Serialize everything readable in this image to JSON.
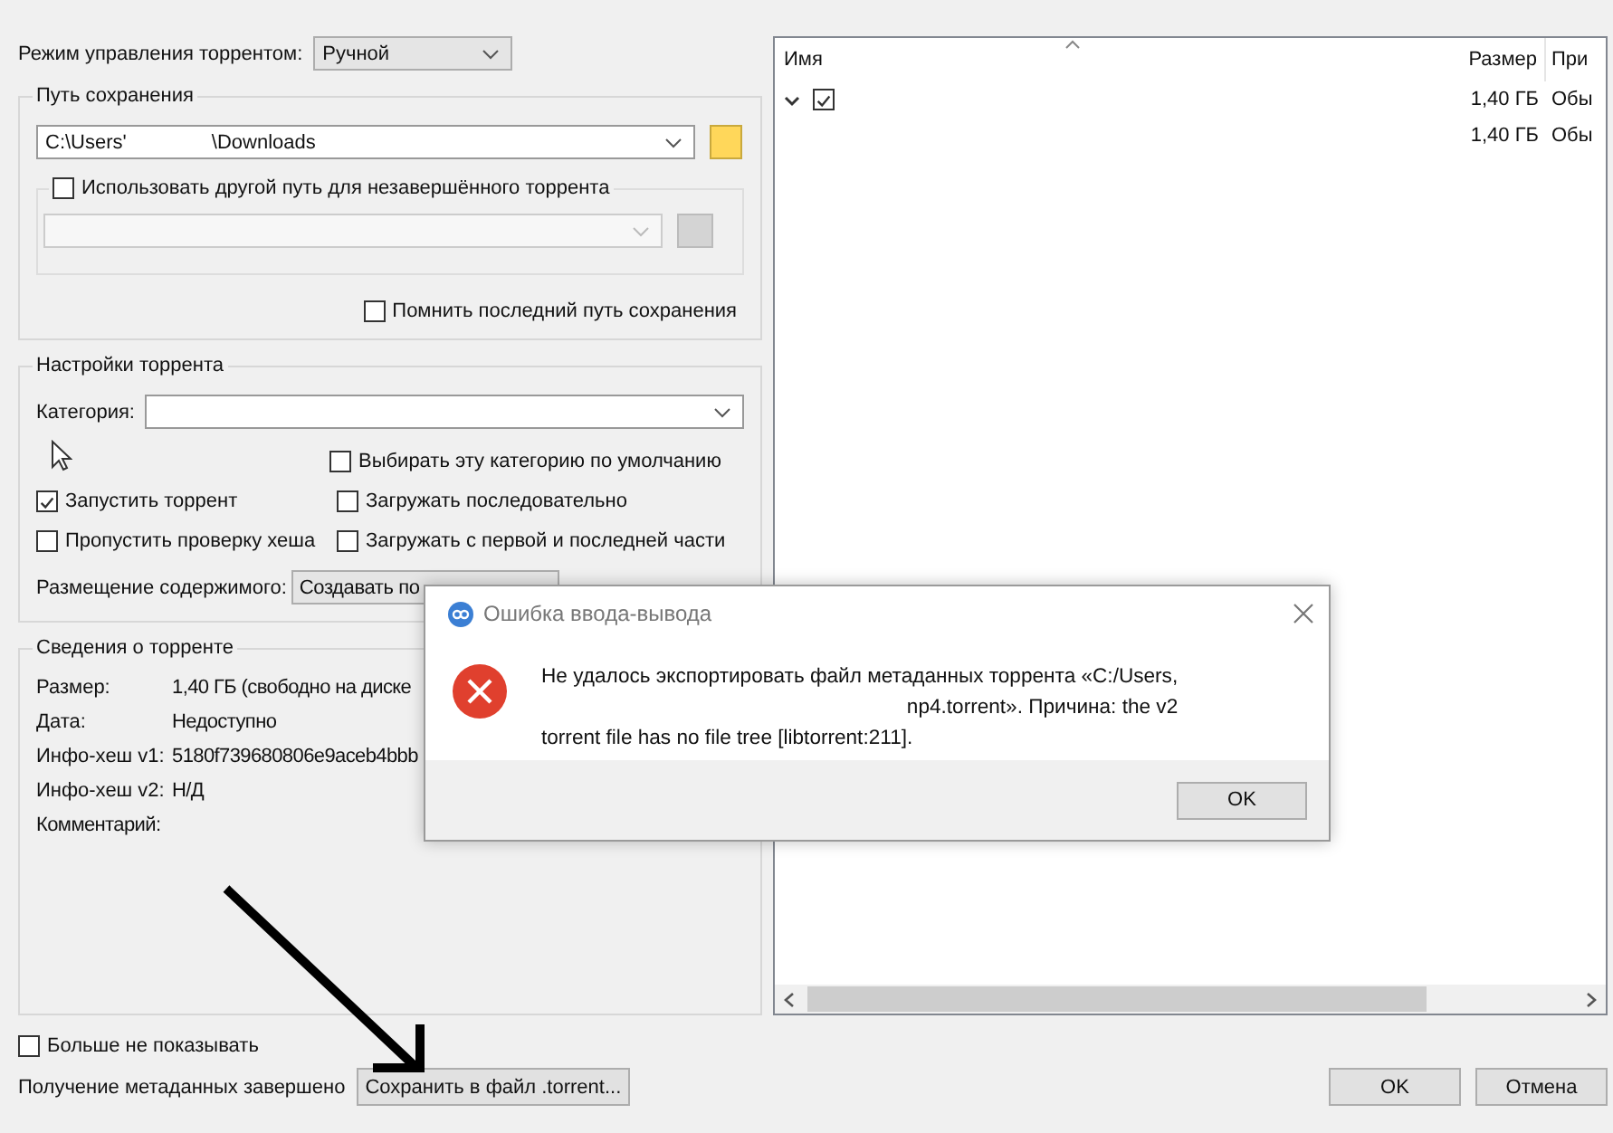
{
  "mode": {
    "label": "Режим управления торрентом:",
    "value": "Ручной"
  },
  "save_path": {
    "title": "Путь сохранения",
    "path_start": "C:\\Users'",
    "path_end": "\\Downloads",
    "alt_path": {
      "label": "Использовать другой путь для незавершённого торрента",
      "checked": false
    },
    "remember": {
      "label": "Помнить последний путь сохранения",
      "checked": false
    }
  },
  "settings": {
    "title": "Настройки торрента",
    "category_label": "Категория:",
    "options": [
      {
        "label": "Выбирать эту категорию по умолчанию",
        "checked": false
      },
      {
        "label": "Запустить торрент",
        "checked": true
      },
      {
        "label": "Загружать последовательно",
        "checked": false
      },
      {
        "label": "Пропустить проверку хеша",
        "checked": false
      },
      {
        "label": "Загружать с первой и последней части",
        "checked": false
      }
    ],
    "layout_label": "Размещение содержимого:",
    "layout_value": "Создавать по"
  },
  "info": {
    "title": "Сведения о торренте",
    "rows": [
      {
        "label": "Размер:",
        "value": "1,40 ГБ (свободно на диске"
      },
      {
        "label": "Дата:",
        "value": "Недоступно"
      },
      {
        "label": "Инфо-хеш v1:",
        "value": "5180f739680806e9aceb4bbb"
      },
      {
        "label": "Инфо-хеш v2:",
        "value": "Н/Д"
      },
      {
        "label": "Комментарий:",
        "value": ""
      }
    ]
  },
  "dont_show": {
    "label": "Больше не показывать",
    "checked": false
  },
  "status": "Получение метаданных завершено",
  "save_button": "Сохранить в файл .torrent...",
  "buttons": [
    "OK",
    "Отмена"
  ],
  "files": {
    "columns": [
      "Имя",
      "Размер",
      "При"
    ],
    "rows": [
      {
        "expanded": true,
        "checked": true,
        "size": "1,40 ГБ",
        "priority": "Обы"
      },
      {
        "size": "1,40 ГБ",
        "priority": "Обы"
      }
    ]
  },
  "dialog": {
    "title": "Ошибка ввода-вывода",
    "lines": [
      "Не удалось экспортировать файл метаданных торрента «C:/Users,",
      "np4.torrent». Причина: the v2",
      "torrent file has no file tree [libtorrent:211]."
    ],
    "button": "OK"
  }
}
